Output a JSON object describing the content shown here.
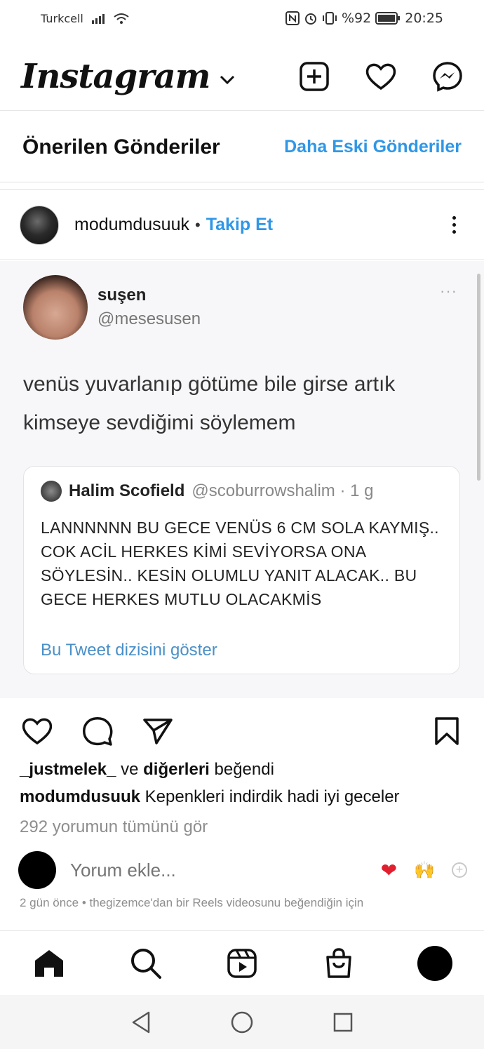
{
  "status_bar": {
    "carrier": "Turkcell",
    "battery": "%92",
    "time": "20:25"
  },
  "header": {
    "logo": "Instagram"
  },
  "suggested": {
    "title": "Önerilen Gönderiler",
    "older_link": "Daha Eski Gönderiler"
  },
  "post": {
    "username": "modumdusuuk",
    "separator": "•",
    "follow_label": "Takip Et",
    "tweet": {
      "name": "suşen",
      "handle": "@mesesusen",
      "more": "···",
      "text": "venüs yuvarlanıp götüme bile girse artık kimseye sevdiğimi söylemem",
      "quote": {
        "name": "Halim Scofield",
        "handle": "@scoburrowshalim · 1 g",
        "text": "LANNNNNN BU GECE VENÜS 6 CM SOLA KAYMIŞ.. COK ACİL HERKES KİMİ SEVİYORSA ONA SÖYLESİN.. KESİN OLUMLU YANIT ALACAK.. BU GECE HERKES MUTLU OLACAKMİS",
        "link": "Bu Tweet dizisini göster"
      }
    },
    "likes": {
      "user": "_justmelek_",
      "connector": "ve",
      "others": "diğerleri",
      "suffix": "beğendi"
    },
    "caption": {
      "user": "modumdusuuk",
      "text": "Kepenkleri indirdik hadi iyi geceler"
    },
    "comments_link": "292 yorumun tümünü gör",
    "comment_placeholder": "Yorum ekle...",
    "quick_reactions": [
      "❤",
      "🙌",
      "+"
    ],
    "meta": "2 gün önce • thegizemce'dan bir Reels videosunu beğendiğin için"
  },
  "colors": {
    "accent_blue": "#2f97e6",
    "muted_text": "#8e8e8e",
    "heart_red": "#e0202f"
  }
}
